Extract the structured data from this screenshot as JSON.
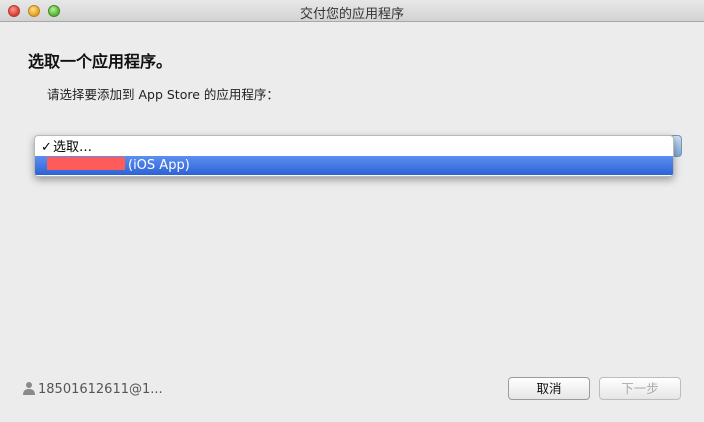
{
  "window": {
    "title": "交付您的应用程序"
  },
  "heading": "选取一个应用程序。",
  "instruction": "请选择要添加到 App Store 的应用程序：",
  "dropdown": {
    "items": [
      {
        "label": "选取…",
        "checked": true
      },
      {
        "label": "(iOS App)",
        "selected": true
      }
    ]
  },
  "account": {
    "label": "18501612611@1..."
  },
  "buttons": {
    "cancel": "取消",
    "next": "下一步"
  },
  "colors": {
    "highlight": "#3a6fe0",
    "redaction": "#ff5b5b"
  }
}
